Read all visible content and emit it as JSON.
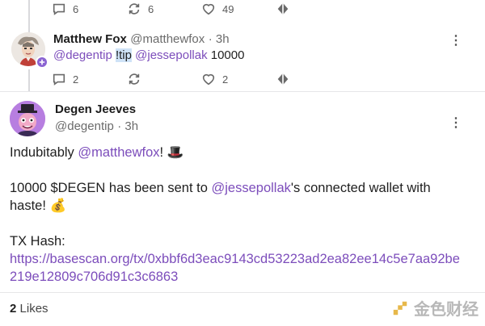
{
  "top_actions": {
    "replies": "6",
    "recasts": "6",
    "likes": "49"
  },
  "reply": {
    "author_name": "Matthew Fox",
    "author_handle": "@matthewfox",
    "time": "· 3h",
    "text_mention1": "@degentip",
    "text_cmd": "!tip",
    "text_mention2": "@jessepollak",
    "text_amount": "10000",
    "replies": "2",
    "likes": "2"
  },
  "post": {
    "author_name": "Degen Jeeves",
    "author_handle": "@degentip",
    "time": "· 3h",
    "line1_prefix": "Indubitably ",
    "line1_mention": "@matthewfox",
    "line1_suffix": "! 🎩",
    "line2_prefix": " 10000 $DEGEN has been sent to ",
    "line2_mention": "@jessepollak",
    "line2_suffix": "'s connected wallet with",
    "line3": "haste! 💰",
    "line4": " TX Hash:",
    "tx_link": "https://basescan.org/tx/0xbbf6d3eac9143cd53223ad2ea82ee14c5e7aa92be219e12809c706d91c3c6863"
  },
  "footer": {
    "likes_count": "2",
    "likes_label": "Likes"
  },
  "watermark": {
    "text": "金色财经"
  },
  "colors": {
    "accent": "#7c4dbb",
    "badge": "#8a63d2"
  }
}
